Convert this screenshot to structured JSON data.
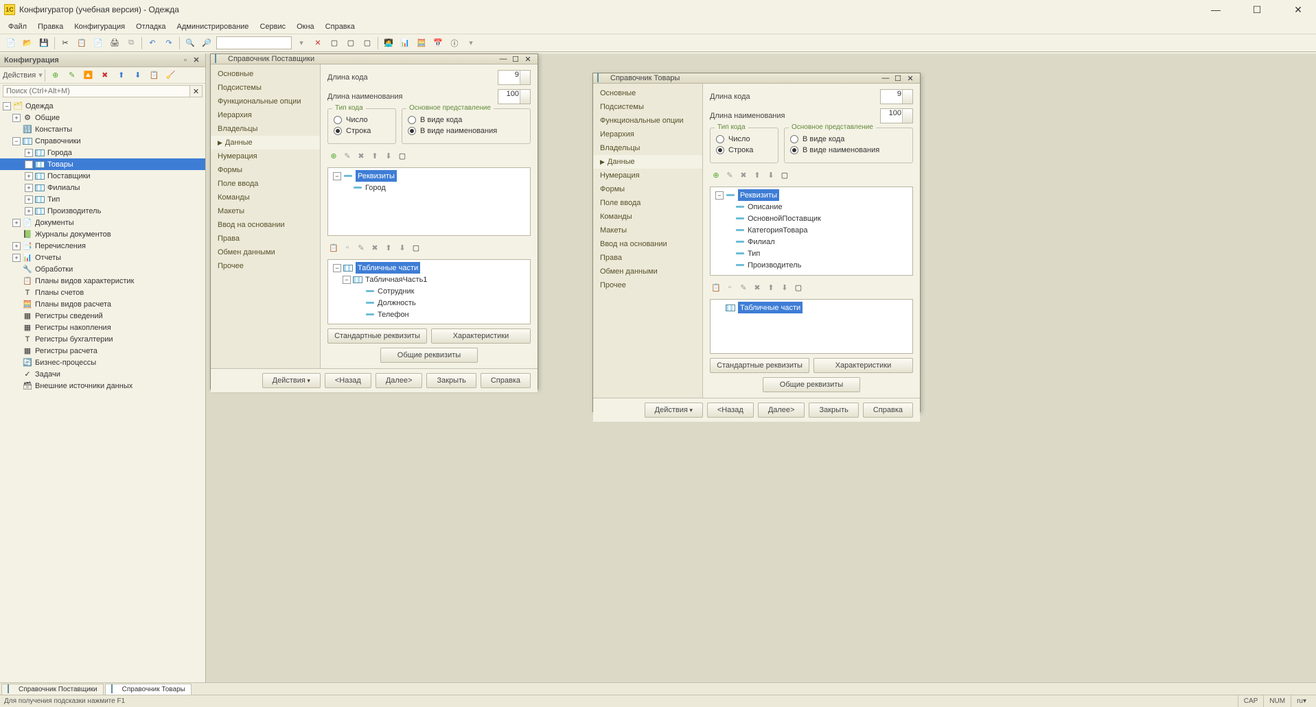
{
  "titlebar": {
    "text": "Конфигуратор (учебная версия) - Одежда"
  },
  "menubar": [
    "Файл",
    "Правка",
    "Конфигурация",
    "Отладка",
    "Администрирование",
    "Сервис",
    "Окна",
    "Справка"
  ],
  "config_panel": {
    "title": "Конфигурация",
    "actions_label": "Действия",
    "search_placeholder": "Поиск (Ctrl+Alt+M)",
    "tree": {
      "root": "Одежда",
      "nodes": [
        {
          "label": "Общие",
          "icon": "gear",
          "exp": "+"
        },
        {
          "label": "Константы",
          "icon": "const"
        },
        {
          "label": "Справочники",
          "icon": "catalog",
          "exp": "-",
          "children": [
            {
              "label": "Города",
              "icon": "catalog",
              "exp": "+"
            },
            {
              "label": "Товары",
              "icon": "catalog",
              "exp": "+",
              "selected": true
            },
            {
              "label": "Поставщики",
              "icon": "catalog",
              "exp": "+"
            },
            {
              "label": "Филиалы",
              "icon": "catalog",
              "exp": "+"
            },
            {
              "label": "Тип",
              "icon": "catalog",
              "exp": "+"
            },
            {
              "label": "Производитель",
              "icon": "catalog",
              "exp": "+"
            }
          ]
        },
        {
          "label": "Документы",
          "icon": "doc",
          "exp": "+"
        },
        {
          "label": "Журналы документов",
          "icon": "journal"
        },
        {
          "label": "Перечисления",
          "icon": "enum",
          "exp": "+"
        },
        {
          "label": "Отчеты",
          "icon": "report",
          "exp": "+"
        },
        {
          "label": "Обработки",
          "icon": "proc"
        },
        {
          "label": "Планы видов характеристик",
          "icon": "plan"
        },
        {
          "label": "Планы счетов",
          "icon": "account"
        },
        {
          "label": "Планы видов расчета",
          "icon": "calc"
        },
        {
          "label": "Регистры сведений",
          "icon": "reg"
        },
        {
          "label": "Регистры накопления",
          "icon": "reg2"
        },
        {
          "label": "Регистры бухгалтерии",
          "icon": "reg3"
        },
        {
          "label": "Регистры расчета",
          "icon": "reg4"
        },
        {
          "label": "Бизнес-процессы",
          "icon": "bp"
        },
        {
          "label": "Задачи",
          "icon": "task"
        },
        {
          "label": "Внешние источники данных",
          "icon": "ext"
        }
      ]
    }
  },
  "win_suppliers": {
    "title": "Справочник Поставщики",
    "code_len_label": "Длина кода",
    "code_len": "9",
    "name_len_label": "Длина наименования",
    "name_len": "100",
    "fs_code_type": "Тип кода",
    "radio_number": "Число",
    "radio_string": "Строка",
    "fs_main_repr": "Основное представление",
    "radio_as_code": "В виде кода",
    "radio_as_name": "В виде наименования",
    "requisites_label": "Реквизиты",
    "requisites": [
      "Город"
    ],
    "tabparts_label": "Табличные части",
    "tabpart1": "ТабличнаяЧасть1",
    "tabpart_cols": [
      "Сотрудник",
      "Должность",
      "Телефон"
    ],
    "btn_std_req": "Стандартные реквизиты",
    "btn_char": "Характеристики",
    "btn_common_req": "Общие реквизиты"
  },
  "win_goods": {
    "title": "Справочник Товары",
    "code_len_label": "Длина кода",
    "code_len": "9",
    "name_len_label": "Длина наименования",
    "name_len": "100",
    "fs_code_type": "Тип кода",
    "radio_number": "Число",
    "radio_string": "Строка",
    "fs_main_repr": "Основное представление",
    "radio_as_code": "В виде кода",
    "radio_as_name": "В виде наименования",
    "requisites_label": "Реквизиты",
    "requisites": [
      "Описание",
      "ОсновнойПоставщик",
      "КатегорияТовара",
      "Филиал",
      "Тип",
      "Производитель"
    ],
    "tabparts_label": "Табличные части",
    "btn_std_req": "Стандартные реквизиты",
    "btn_char": "Характеристики",
    "btn_common_req": "Общие реквизиты"
  },
  "doc_nav": [
    "Основные",
    "Подсистемы",
    "Функциональные опции",
    "Иерархия",
    "Владельцы",
    "Данные",
    "Нумерация",
    "Формы",
    "Поле ввода",
    "Команды",
    "Макеты",
    "Ввод на основании",
    "Права",
    "Обмен данными",
    "Прочее"
  ],
  "doc_footer": {
    "actions": "Действия",
    "back": "<Назад",
    "next": "Далее>",
    "close": "Закрыть",
    "help": "Справка"
  },
  "bottom_tabs": [
    "Справочник Поставщики",
    "Справочник Товары"
  ],
  "statusbar": {
    "hint": "Для получения подсказки нажмите F1",
    "cap": "CAP",
    "num": "NUM",
    "lang": "ru"
  }
}
